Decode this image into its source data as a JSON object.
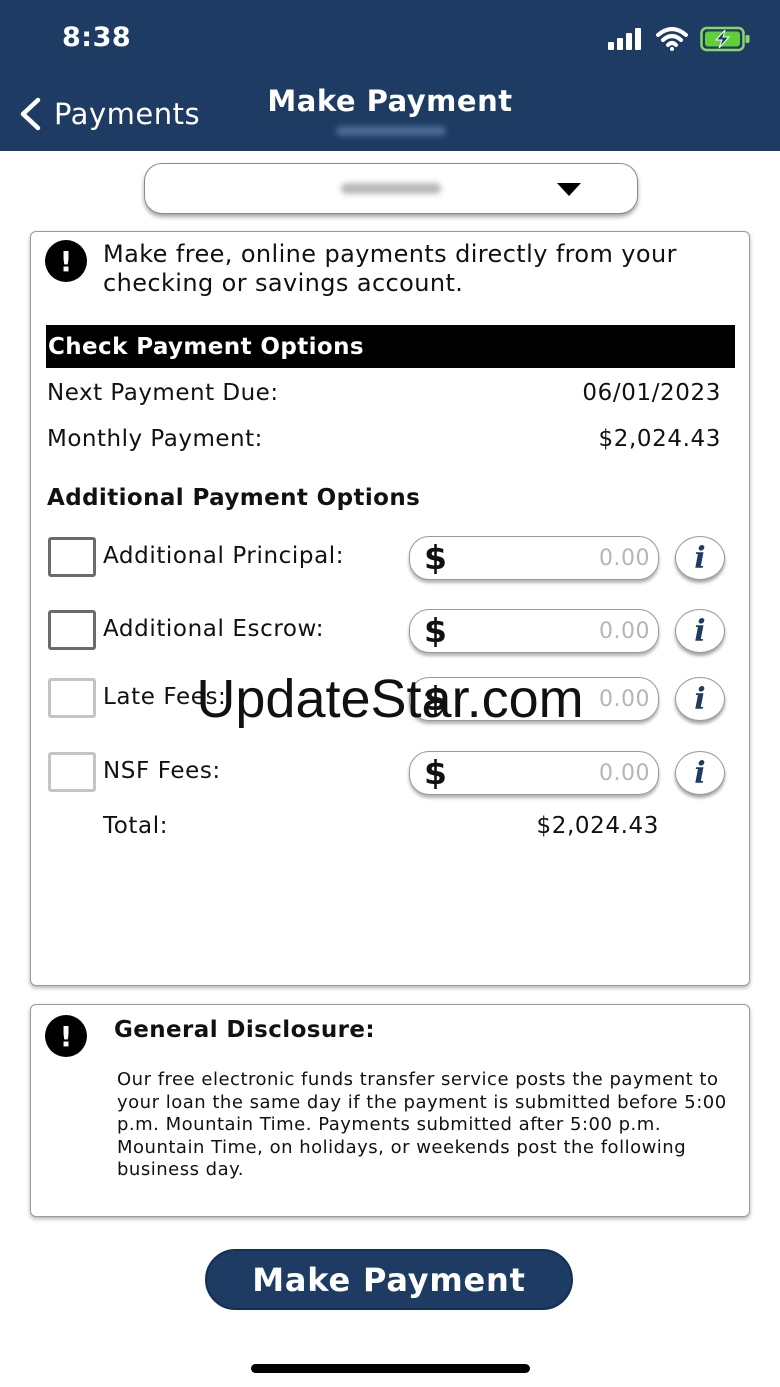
{
  "status_bar": {
    "time": "8:38"
  },
  "nav": {
    "back_label": "Payments",
    "title": "Make Payment"
  },
  "intro": {
    "text": "Make free, online payments directly from your checking or savings account."
  },
  "check_options": {
    "heading": "Check Payment Options",
    "next_due_label": "Next Payment Due:",
    "next_due_value": "06/01/2023",
    "monthly_label": "Monthly Payment:",
    "monthly_value": "$2,024.43"
  },
  "additional": {
    "heading": "Additional Payment Options",
    "items": [
      {
        "label": "Additional Principal:",
        "currency": "$",
        "value": "0.00"
      },
      {
        "label": "Additional Escrow:",
        "currency": "$",
        "value": "0.00"
      },
      {
        "label": "Late Fees:",
        "currency": "$",
        "value": "0.00"
      },
      {
        "label": "NSF Fees:",
        "currency": "$",
        "value": "0.00"
      }
    ],
    "info_glyph": "i",
    "total_label": "Total:",
    "total_value": "$2,024.43"
  },
  "disclosure": {
    "title": "General Disclosure:",
    "body": "Our free electronic funds transfer service posts the payment to your loan the same day if the payment is submitted before 5:00 p.m. Mountain Time. Payments submitted after 5:00 p.m. Mountain Time, on holidays, or weekends post the following business day."
  },
  "alert_glyph": "!",
  "submit": {
    "label": "Make Payment"
  },
  "watermark": "UpdateStar.com",
  "colors": {
    "brand": "#1d3b63",
    "section_bar": "#000000",
    "placeholder": "#b5b5b5"
  },
  "icons": [
    "signal-icon",
    "wifi-icon",
    "battery-charging-icon",
    "chevron-left-icon",
    "caret-down-icon",
    "alert-icon",
    "dollar-icon",
    "info-icon"
  ]
}
